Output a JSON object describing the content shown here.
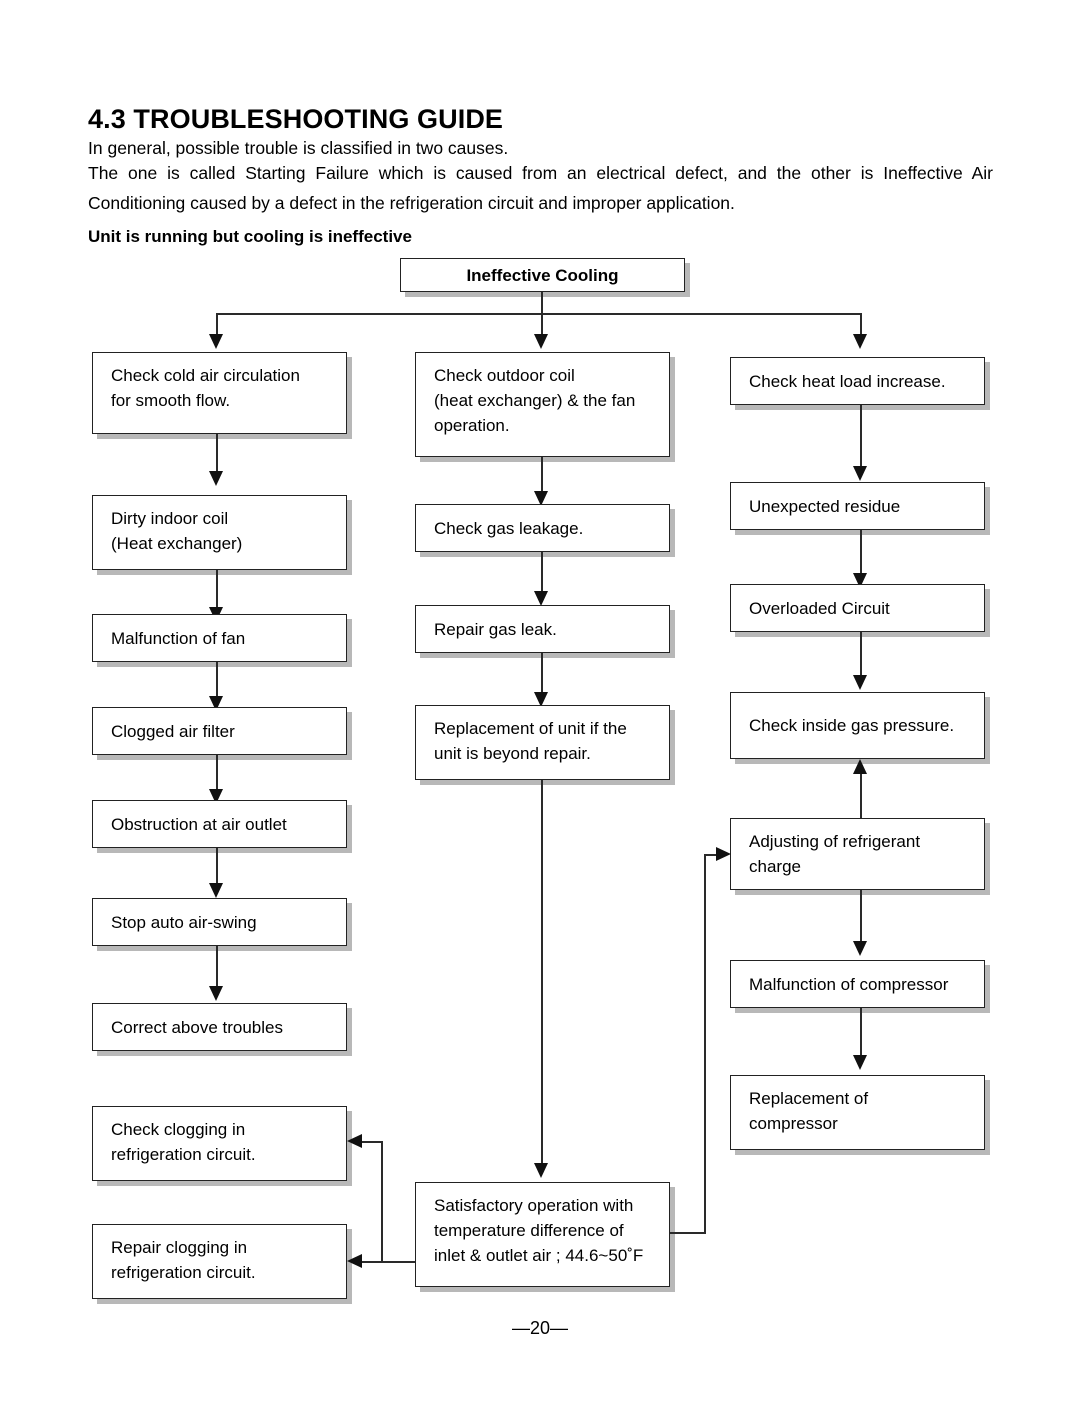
{
  "document": {
    "heading": "4.3 TROUBLESHOOTING GUIDE",
    "intro_line_1": "In general, possible trouble is classified in two causes.",
    "intro_line_2": "The one is called Starting Failure which is caused from an electrical defect, and the other is Ineffective Air Conditioning caused by a defect in the refrigeration circuit and improper application.",
    "subheading": "Unit is running but cooling is ineffective",
    "page_number": "—20—"
  },
  "flowchart": {
    "root": {
      "label": "Ineffective Cooling"
    },
    "column_left": [
      {
        "label": "Check cold  air circulation\nfor smooth flow."
      },
      {
        "label": "Dirty indoor coil\n(Heat exchanger)"
      },
      {
        "label": "Malfunction of fan"
      },
      {
        "label": "Clogged air filter"
      },
      {
        "label": "Obstruction at air outlet"
      },
      {
        "label": "Stop auto air-swing"
      },
      {
        "label": "Correct above troubles"
      },
      {
        "label": "Check clogging in\nrefrigeration circuit."
      },
      {
        "label": "Repair clogging in\nrefrigeration circuit."
      }
    ],
    "column_middle": [
      {
        "label": "Check outdoor coil\n(heat exchanger) & the fan\noperation."
      },
      {
        "label": "Check gas leakage."
      },
      {
        "label": "Repair gas leak."
      },
      {
        "label": "Replacement of unit if the\nunit is beyond repair."
      },
      {
        "label": "Satisfactory operation with\ntemperature difference of\ninlet & outlet air ; 44.6~50˚F"
      }
    ],
    "column_right": [
      {
        "label": "Check heat load increase."
      },
      {
        "label": "Unexpected residue"
      },
      {
        "label": "Overloaded Circuit"
      },
      {
        "label": "Check inside gas pressure."
      },
      {
        "label": "Adjusting of refrigerant\ncharge"
      },
      {
        "label": "Malfunction of compressor"
      },
      {
        "label": "Replacement of\ncompressor"
      }
    ]
  },
  "colors": {
    "box_border": "#222222",
    "box_shadow": "#b8b8b8",
    "connector": "#2a2a2a",
    "background": "#ffffff"
  }
}
